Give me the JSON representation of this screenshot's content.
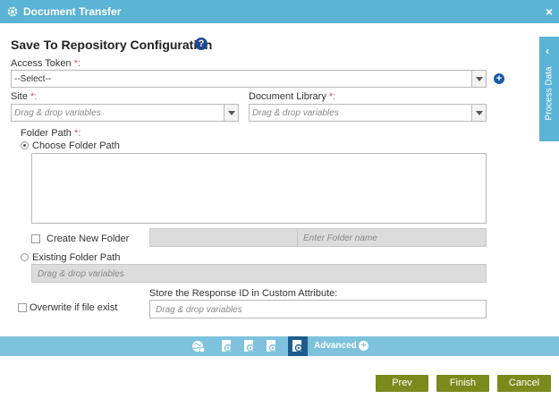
{
  "window": {
    "title": "Document Transfer",
    "close_label": "×"
  },
  "heading": {
    "title": "Save To Repository Configuration",
    "help_label": "?"
  },
  "access_token": {
    "label": "Access Token",
    "required": "*:",
    "selected": "--Select--",
    "add_label": "+"
  },
  "site": {
    "label": "Site",
    "required": "*:",
    "placeholder": "Drag & drop variables"
  },
  "document_library": {
    "label": "Document Library",
    "required": "*:",
    "placeholder": "Drag & drop variables"
  },
  "folder_path": {
    "label": "Folder Path",
    "required": "*:",
    "choose_label": "Choose Folder Path",
    "create_new_label": "Create New Folder",
    "folder_name_placeholder": "Enter Folder name",
    "existing_label": "Existing Folder Path",
    "existing_placeholder": "Drag & drop variables"
  },
  "overwrite": {
    "label": "Overwrite if file exist"
  },
  "response_id": {
    "label": "Store the Response ID in Custom Attribute",
    "colon": ":",
    "placeholder": "Drag & drop variables"
  },
  "side_panel": {
    "label": "Process Data",
    "chevron": "‹"
  },
  "bottom_bar": {
    "advanced_label": "Advanced",
    "advanced_plus": "+"
  },
  "footer": {
    "prev_label": "Prev",
    "finish_label": "Finish",
    "cancel_label": "Cancel"
  },
  "colors": {
    "header": "#5bb3d6",
    "button": "#7a8a1c",
    "active_tab": "#1d5d8e"
  }
}
